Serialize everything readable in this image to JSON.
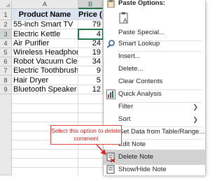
{
  "sheet": {
    "columns": [
      "A",
      "B"
    ],
    "rows": [
      "1",
      "2",
      "3",
      "4",
      "5",
      "6",
      "7",
      "8",
      "9"
    ],
    "headers": {
      "product": "Product Name",
      "price": "Price ($)"
    },
    "data": [
      {
        "product": "55-inch Smart TV",
        "price": "79"
      },
      {
        "product": "Electric Kettle",
        "price": "4"
      },
      {
        "product": "Air Purifier",
        "price": "24"
      },
      {
        "product": "Wireless Headphones",
        "price": "19"
      },
      {
        "product": "Robot Vacuum Cleaner",
        "price": "34"
      },
      {
        "product": "Electric Toothbrush",
        "price": "9"
      },
      {
        "product": "Hair Dryer",
        "price": "5"
      },
      {
        "product": "Bluetooth Speaker",
        "price": "12"
      }
    ]
  },
  "menu": {
    "paste_options_label": "Paste Options:",
    "items": [
      {
        "label": "Paste Special...",
        "icon": "none"
      },
      {
        "label": "Smart Lookup",
        "icon": "search-icon"
      },
      {
        "label": "Insert...",
        "icon": "none"
      },
      {
        "label": "Delete...",
        "icon": "none"
      },
      {
        "label": "Clear Contents",
        "icon": "none"
      },
      {
        "label": "Quick Analysis",
        "icon": "quick-analysis-icon"
      },
      {
        "label": "Filter",
        "icon": "none",
        "submenu": true
      },
      {
        "label": "Sort",
        "icon": "none",
        "submenu": true
      },
      {
        "label": "Get Data from Table/Range...",
        "icon": "table-icon"
      },
      {
        "label": "Edit Note",
        "icon": "none"
      },
      {
        "label": "Delete Note",
        "icon": "delete-note-icon",
        "highlighted": true
      },
      {
        "label": "Show/Hide Note",
        "icon": "show-hide-note-icon"
      }
    ]
  },
  "callout": {
    "text": "Select this option to delete comment",
    "color": "#e02020"
  },
  "colors": {
    "header_fill": "#dbe5f1",
    "selection": "#217346",
    "highlight": "#d2d2d2"
  }
}
